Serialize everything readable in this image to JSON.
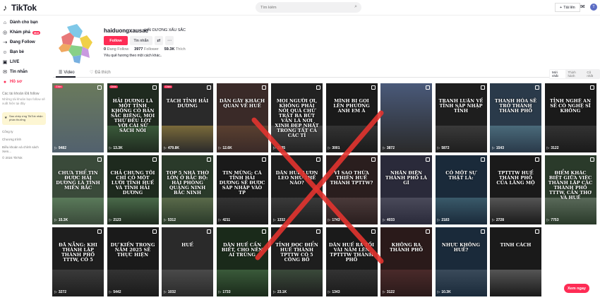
{
  "header": {
    "logo_text": "TikTok",
    "search_placeholder": "Tìm kiếm",
    "upload_label": "Tải lên"
  },
  "sidebar": {
    "items": [
      {
        "label": "Dành cho bạn",
        "icon": "home-icon"
      },
      {
        "label": "Khám phá",
        "icon": "compass-icon",
        "badge": "Mới"
      },
      {
        "label": "Đang Follow",
        "icon": "follow-icon"
      },
      {
        "label": "Bạn bè",
        "icon": "friends-icon"
      },
      {
        "label": "LIVE",
        "icon": "live-icon"
      },
      {
        "label": "Tin nhắn",
        "icon": "inbox-icon"
      },
      {
        "label": "Hồ sơ",
        "icon": "profile-icon"
      }
    ],
    "followed_heading": "Các tài khoản Đã follow",
    "followed_hint": "Những tài khoản bạn follow sẽ xuất hiện tại đây",
    "promo_text": "Sao chép ứng TikTok nhận phần thưởng",
    "links": [
      "Công ty",
      "Chương trình",
      "Điều khoản và chính sách",
      "Xem...",
      "© 2024 TikTok"
    ]
  },
  "profile": {
    "handle": "haiduongxausac",
    "display_name": "HẢI DƯƠNG XẤU SẮC",
    "follow_label": "Follow",
    "message_label": "Tin nhắn",
    "following_count": "0",
    "following_label": "Đang Follow",
    "followers_count": "3977",
    "followers_label": "Follower",
    "likes_count": "59.3K",
    "likes_label": "Thích",
    "bio": "Yêu quê hương theo một cách khác.."
  },
  "tabs": [
    {
      "label": "Video",
      "active": true
    },
    {
      "label": "Đã thích",
      "active": false
    }
  ],
  "sort_options": [
    {
      "label": "Mới nhất",
      "active": true
    },
    {
      "label": "Thịnh hành",
      "active": false
    },
    {
      "label": "Cũ nhất",
      "active": false
    }
  ],
  "videos": [
    {
      "title": "",
      "views": "9482",
      "bg": "#52616e",
      "photo": "#6a7a5c",
      "tag": "Ghim"
    },
    {
      "title": "HẢI DƯƠNG LÀ MỘT TỈNH KHÔNG CÓ BẢN SẮC RIÊNG, MỌI THỨ ĐỀU LỚT VỚI CÁI SỬ SÁCH NÓI",
      "views": "13.3K",
      "bg": "#1f2a1f",
      "photo": "#3a5a3a",
      "tag": "Ghim"
    },
    {
      "title": "TÁCH TỈNH HẢI DƯƠNG",
      "views": "479.8K",
      "bg": "#2a2a2a",
      "photo": "#7a6a3a",
      "tag": "Ghim"
    },
    {
      "title": "DÂN GÂY KHÁCH QUAN VỀ HUẾ",
      "views": "12.6K",
      "bg": "#3a2a28",
      "photo": "#5a4030",
      "tag": ""
    },
    {
      "title": "MỌI NGƯỜI ƠI, KHÔNG PHẢI NÓI QUÁ CHỨ TRẤT BA BỨT VẦN LÀ NƠI XINH ĐẸP NHẤT TRONG TẤT CẢ CÁC TỈ",
      "views": "2035",
      "bg": "#222",
      "photo": "#444",
      "tag": ""
    },
    {
      "title": "MÌNH BỊ GỌI LÊN PHƯỜNG ANH EM À",
      "views": "3001",
      "bg": "#1a1a1a",
      "photo": "#333",
      "tag": ""
    },
    {
      "title": "",
      "views": "3872",
      "bg": "#2a2a2a",
      "photo": "#4a5a7a",
      "tag": ""
    },
    {
      "title": "TRANH LUẬN VỀ TỈNH SÁP NHẬP TỈNH",
      "views": "5872",
      "bg": "#1e1e1e",
      "photo": "#3a3a3a",
      "tag": ""
    },
    {
      "title": "THANH HÓA SẼ TRỞ THÀNH THÀNH PHỐ",
      "views": "1543",
      "bg": "#2a3a4a",
      "photo": "#4a6a7a",
      "tag": ""
    },
    {
      "title": "TỈNH NGHỆ AN SẼ CÓ NGHỆ SĨ KHÔNG",
      "views": "3122",
      "bg": "#1a1a1a",
      "photo": "#333",
      "tag": ""
    },
    {
      "title": "CHƯA THỂ TIN ĐƯỢC HẢI DƯƠNG LÀ TỈNH MIỀN BẮC",
      "views": "15.3K",
      "bg": "#3a4a3a",
      "photo": "#5a7a5a",
      "tag": ""
    },
    {
      "title": "CHẢ CHƯNG TÔI CHỈ CÓ MỘT LƯỚI TỈNH HUẾ VÀ TỈNH HẢI DƯƠNG",
      "views": "2123",
      "bg": "#1e2a1e",
      "photo": "#4a6a4a",
      "tag": ""
    },
    {
      "title": "TOP 5 NHÀ THỜ LỚN Ở BẮC BỘ: HẢI PHÒNG QUẢNG NINH BẮC NINH",
      "views": "5312",
      "bg": "#2a3a2a",
      "photo": "#5a6a4a",
      "tag": ""
    },
    {
      "title": "TIN MỪNG: CÁ TỈNH HẢI DƯƠNG SẼ ĐƯỢC SÁP NHẬP VÀO TP",
      "views": "4211",
      "bg": "#1a1a1a",
      "photo": "#333",
      "tag": ""
    },
    {
      "title": "DÂN HUẾ LƯƠN LEO NHƯ THẾ NÀO?",
      "views": "1332",
      "bg": "#1e1e1e",
      "photo": "#3a3a3a",
      "tag": ""
    },
    {
      "title": "VÌ SAO THỪA THIÊN HUẾ THÀNH TPTTW?",
      "views": "1743",
      "bg": "#2a1e1e",
      "photo": "#4a3a3a",
      "tag": ""
    },
    {
      "title": "NHÂN ĐIỆN THÀNH PHỐ LÀ GÌ",
      "views": "4033",
      "bg": "#2a2a3a",
      "photo": "#4a4a5a",
      "tag": ""
    },
    {
      "title": "CÓ MỘT SỰ THẬT LÀ:",
      "views": "2183",
      "bg": "#1a2a3a",
      "photo": "#3a5a6a",
      "tag": ""
    },
    {
      "title": "TPTTTW HUẾ THÀNH PHỐ CỦA LĂNG MỘ",
      "views": "2728",
      "bg": "#1a1a1a",
      "photo": "#555",
      "tag": ""
    },
    {
      "title": "ĐIỂM KHÁC BIỆT GIỮA VIỆC THÀNH LẬP CÁC THÀNH PHỐ TTTW, CẦN THƠ VÀ HUẾ",
      "views": "7753",
      "bg": "#2a3a2a",
      "photo": "#5a6a5a",
      "tag": ""
    },
    {
      "title": "ĐÃ NẴNG: KHI THÀNH LẬP THÀNH PHỐ TTTW, CÓ 5",
      "views": "3272",
      "bg": "#1e1e1e",
      "photo": "#3a3a3a",
      "tag": ""
    },
    {
      "title": "DỰ KIẾN TRONG NĂM 2025 SẼ THỰC HIỆN",
      "views": "5442",
      "bg": "#1a1a1a",
      "photo": "#333",
      "tag": ""
    },
    {
      "title": "HUẾ",
      "views": "1032",
      "bg": "#2a2a2a",
      "photo": "#4a4a4a",
      "tag": ""
    },
    {
      "title": "DÂN HUẾ CẦN BIẾT, CHO NÊN AI TRÙNG",
      "views": "1733",
      "bg": "#1a2a1a",
      "photo": "#3a5a3a",
      "tag": ""
    },
    {
      "title": "TỈNH ĐỌC ĐIỂN HUẾ THÀNH TPTTW CÓ 5 CÔNG BỐ",
      "views": "23.1K",
      "bg": "#1e1e1e",
      "photo": "#3a4a3a",
      "tag": ""
    },
    {
      "title": "DÂN HUẾ RA TỐI VÀI NĂM LÊN TPTTTW THÀNH PHỐ",
      "views": "1343",
      "bg": "#1a1a1a",
      "photo": "#333",
      "tag": ""
    },
    {
      "title": "KHÔNG RA THÀNH PHỐ",
      "views": "3122",
      "bg": "#2a1a1a",
      "photo": "#4a2a2a",
      "tag": ""
    },
    {
      "title": "NHỰC KHÔNG HUẾ?",
      "views": "10.3K",
      "bg": "#1a2a3a",
      "photo": "#3a4a5a",
      "tag": ""
    },
    {
      "title": "TINH CÁCH",
      "views": "",
      "bg": "#1a1a1a",
      "photo": "#555",
      "tag": ""
    }
  ],
  "watch_button": "Xem ngay",
  "colors": {
    "accent": "#fe2c55",
    "cross": "#e3342f"
  }
}
